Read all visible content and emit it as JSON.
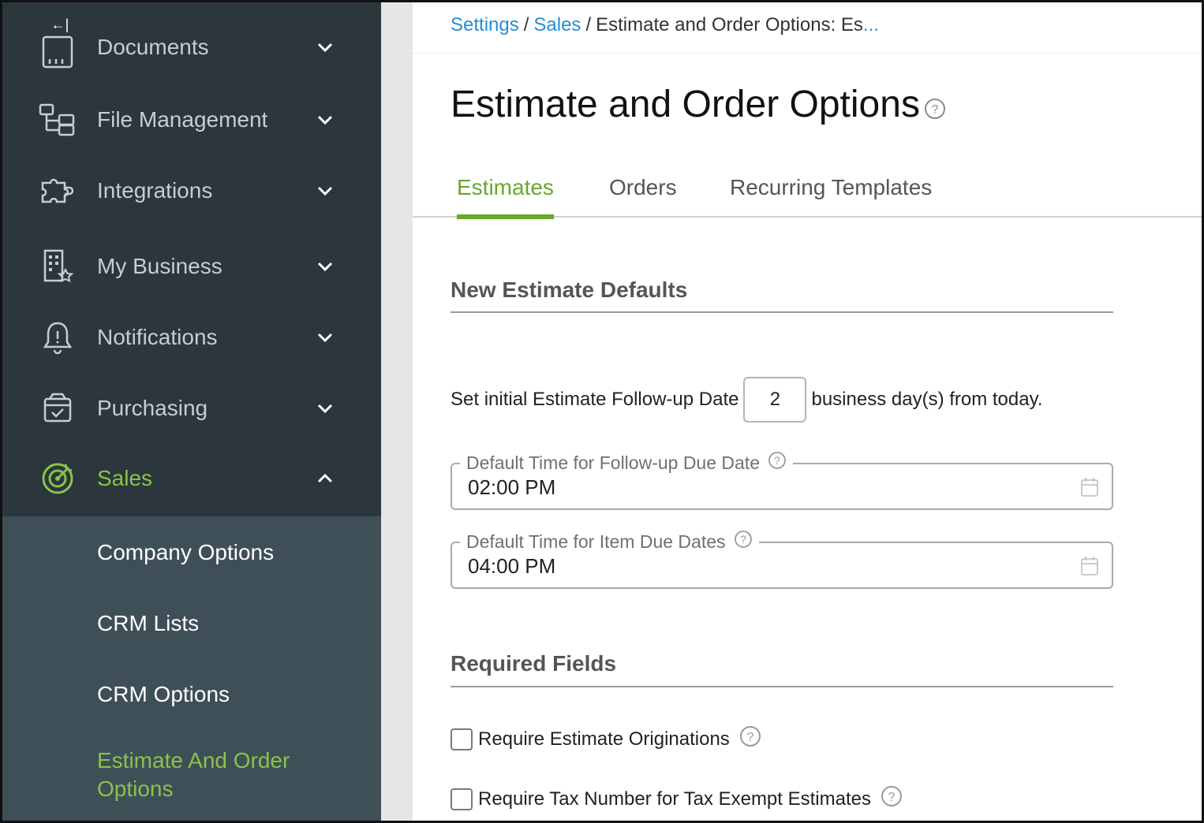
{
  "sidebar": {
    "collapse_glyph": "←|",
    "items": [
      {
        "label": "Documents",
        "icon": "documents-icon"
      },
      {
        "label": "File Management",
        "icon": "file-management-icon"
      },
      {
        "label": "Integrations",
        "icon": "puzzle-icon"
      },
      {
        "label": "My Business",
        "icon": "building-star-icon"
      },
      {
        "label": "Notifications",
        "icon": "bell-icon"
      },
      {
        "label": "Purchasing",
        "icon": "purchasing-box-icon"
      },
      {
        "label": "Sales",
        "icon": "sales-target-icon",
        "active": true,
        "expanded": true
      }
    ],
    "sales_submenu": [
      {
        "label": "Company Options"
      },
      {
        "label": "CRM Lists"
      },
      {
        "label": "CRM Options"
      },
      {
        "label": "Estimate And Order Options",
        "active": true
      }
    ]
  },
  "breadcrumb": {
    "items": [
      "Settings",
      "Sales"
    ],
    "current": "Estimate and Order Options: Es",
    "ellipsis": "..."
  },
  "page": {
    "title": "Estimate and Order Options"
  },
  "tabs": [
    {
      "label": "Estimates",
      "active": true
    },
    {
      "label": "Orders"
    },
    {
      "label": "Recurring Templates"
    }
  ],
  "new_estimate_defaults": {
    "heading": "New Estimate Defaults",
    "followup_prefix": "Set initial Estimate Follow-up Date",
    "followup_days": "2",
    "followup_suffix": "business day(s) from today.",
    "followup_time_label": "Default Time for Follow-up Due Date",
    "followup_time_value": "02:00 PM",
    "item_time_label": "Default Time for Item Due Dates",
    "item_time_value": "04:00 PM"
  },
  "required_fields": {
    "heading": "Required Fields",
    "options": [
      {
        "label": "Require Estimate Originations",
        "checked": false
      },
      {
        "label": "Require Tax Number for Tax Exempt Estimates",
        "checked": false
      }
    ]
  },
  "colors": {
    "sidebar_bg": "#2b363d",
    "submenu_bg": "#3f4f58",
    "accent_green": "#6aa72d",
    "link_blue": "#1f8fd6"
  }
}
